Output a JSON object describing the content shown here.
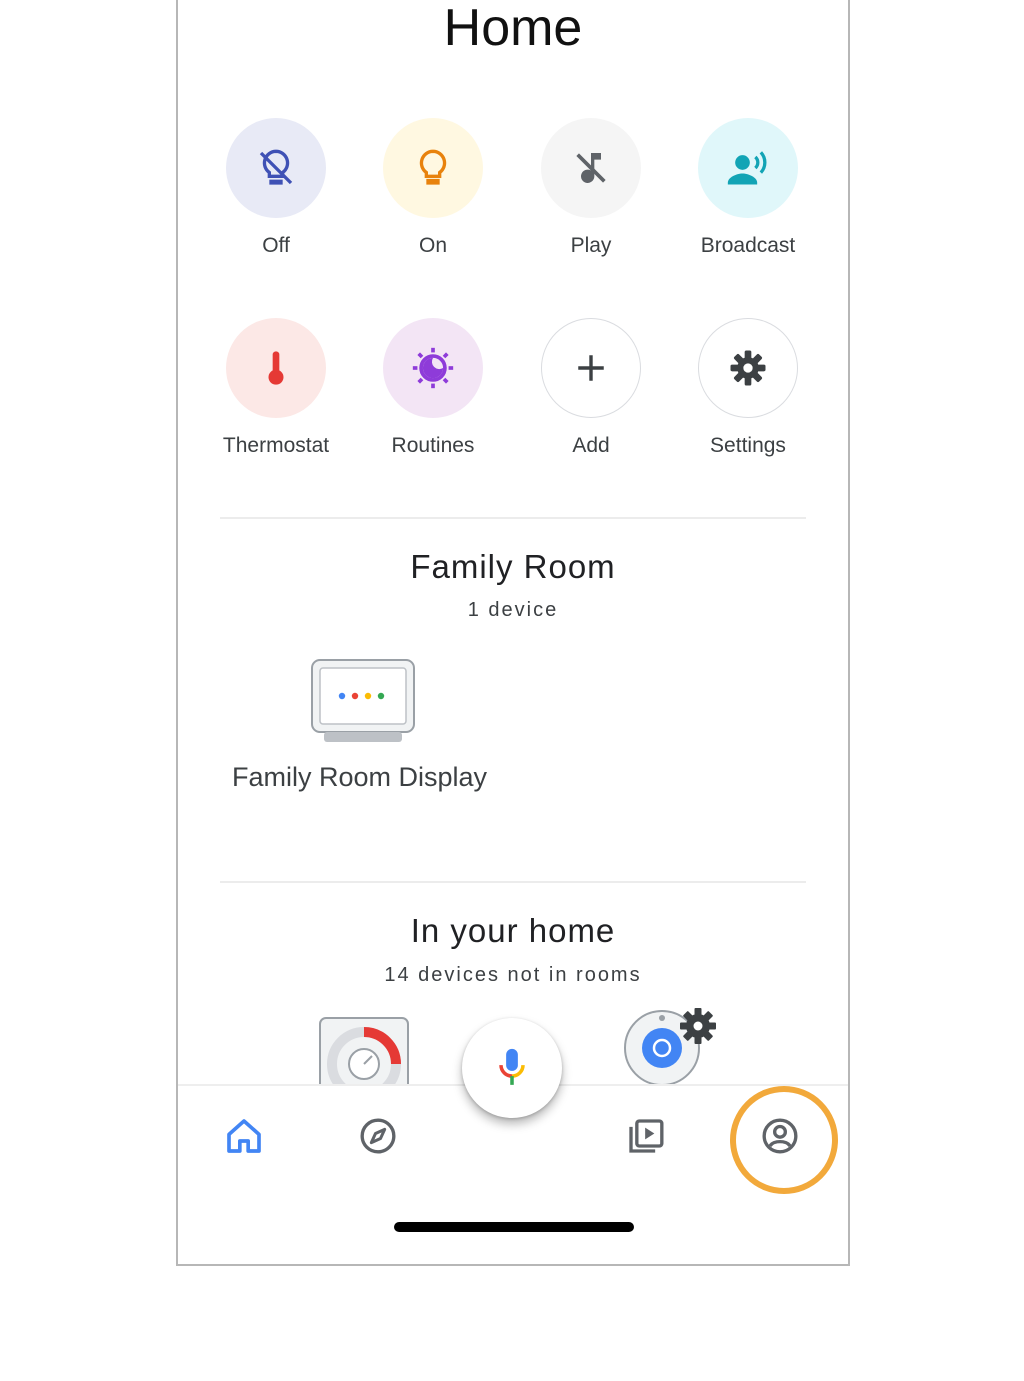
{
  "header": {
    "title": "Home"
  },
  "actions": [
    {
      "label": "Off",
      "icon": "light-off-icon",
      "bg": "#e8eaf6",
      "color": "#3f51b5"
    },
    {
      "label": "On",
      "icon": "lightbulb-icon",
      "bg": "#fff8e1",
      "color": "#e8820c"
    },
    {
      "label": "Play",
      "icon": "music-off-icon",
      "bg": "#f5f5f5",
      "color": "#5f6368"
    },
    {
      "label": "Broadcast",
      "icon": "broadcast-icon",
      "bg": "#e0f7fa",
      "color": "#12a4b5"
    },
    {
      "label": "Thermostat",
      "icon": "thermometer-icon",
      "bg": "#fce8e6",
      "color": "#e53935"
    },
    {
      "label": "Routines",
      "icon": "routines-icon",
      "bg": "#f3e5f5",
      "color": "#8e3bd9"
    },
    {
      "label": "Add",
      "icon": "plus-icon",
      "bg": "#ffffff",
      "color": "#3c4043"
    },
    {
      "label": "Settings",
      "icon": "gear-icon",
      "bg": "#ffffff",
      "color": "#3c4043"
    }
  ],
  "family_room": {
    "title": "Family Room",
    "subtitle": "1 device",
    "devices": [
      {
        "name": "Family Room Display",
        "icon": "smart-display-icon"
      }
    ]
  },
  "in_your_home": {
    "title": "In your home",
    "subtitle": "14 devices not in rooms"
  },
  "nav": {
    "items": [
      "home-icon",
      "explore-icon",
      "mic-icon",
      "media-icon",
      "account-icon"
    ],
    "active": "home-icon"
  },
  "colors": {
    "accent": "#4285f4",
    "highlight": "#f2a93b"
  }
}
